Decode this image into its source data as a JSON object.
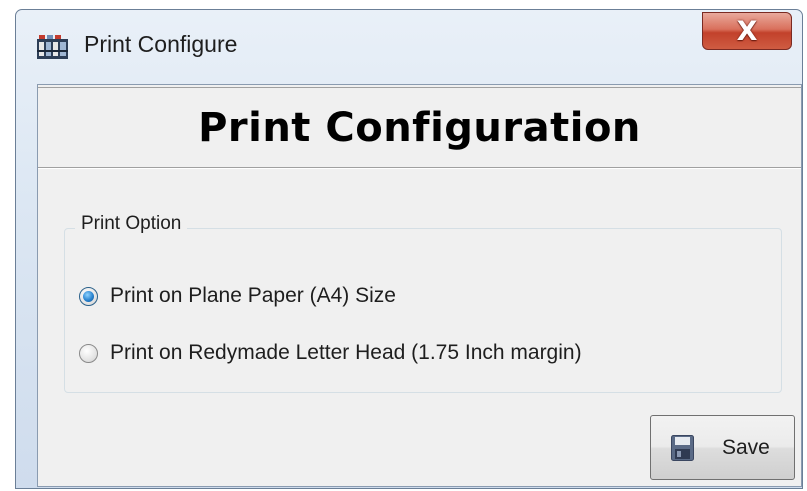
{
  "window": {
    "title": "Print Configure",
    "close_glyph": "X",
    "icon": "app-logo-icon"
  },
  "header": {
    "title": "Print Configuration"
  },
  "print_option_group": {
    "legend": "Print Option",
    "options": [
      {
        "label": "Print on Plane Paper (A4) Size",
        "checked": true
      },
      {
        "label": "Print on Redymade Letter Head (1.75 Inch margin)",
        "checked": false
      }
    ]
  },
  "actions": {
    "save_label": "Save",
    "save_icon": "floppy-disk-icon"
  },
  "colors": {
    "close_button": "#c9533d",
    "radio_selected": "#2a84d0",
    "client_background": "#f0f0f0"
  }
}
